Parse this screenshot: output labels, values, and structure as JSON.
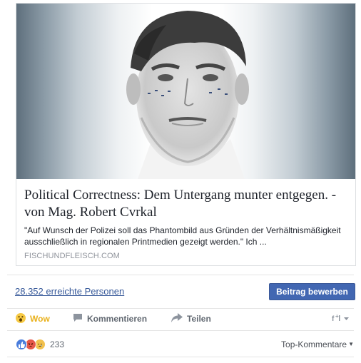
{
  "card": {
    "title": "Political Correctness: Dem Untergang munter entgegen. - von Mag. Robert Cvrkal",
    "description": "\"Auf Wunsch der Polizei soll das Phantombild aus Gründen der Verhältnismäßigkeit ausschließlich in regionalen Printmedien gezeigt werden.\" Ich ...",
    "source": "FISCHUNDFLEISCH.COM"
  },
  "stats": {
    "reach": "28.352 erreichte Personen",
    "promote_label": "Beitrag bewerben"
  },
  "actions": {
    "wow_label": "Wow",
    "comment_label": "Kommentieren",
    "share_label": "Teilen"
  },
  "summary": {
    "count": "233",
    "sort_label": "Top-Kommentare"
  },
  "colors": {
    "link": "#365899",
    "button": "#4267b2",
    "wow": "#e9b11c"
  },
  "icons": [
    "wow-reaction-icon",
    "comment-icon",
    "share-icon",
    "page-audience-icon",
    "like-reaction-icon",
    "angry-reaction-icon",
    "sad-reaction-icon"
  ]
}
